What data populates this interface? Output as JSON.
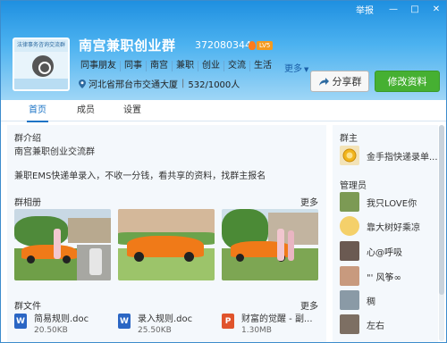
{
  "window": {
    "report_label": "举报",
    "min_glyph": "—",
    "max_glyph": "□",
    "close_glyph": "✕"
  },
  "group": {
    "avatar_banner": "法律事务咨询交流群",
    "name": "南宫兼职创业群",
    "id": "372080344",
    "level_badge": "LV5",
    "tags": [
      "同事朋友",
      "同事",
      "南宫",
      "兼职",
      "创业",
      "交流",
      "生活"
    ],
    "more_label": "更多",
    "location": "河北省邢台市交通大厦",
    "member_count": "532/1000人"
  },
  "actions": {
    "share_label": "分享群",
    "edit_label": "修改资料"
  },
  "tabs": [
    {
      "label": "首页",
      "active": true
    },
    {
      "label": "成员",
      "active": false
    },
    {
      "label": "设置",
      "active": false
    }
  ],
  "intro": {
    "title": "群介绍",
    "line1": "南宫兼职创业交流群",
    "line2": "兼职EMS快递单录入，不收一分钱，看共享的资料，找群主报名"
  },
  "album": {
    "title": "群相册",
    "more_label": "更多"
  },
  "files": {
    "title": "群文件",
    "more_label": "更多",
    "items": [
      {
        "icon": "W",
        "name": "简易规则.doc",
        "size": "20.50KB"
      },
      {
        "icon": "W",
        "name": "录入规则.doc",
        "size": "25.50KB"
      },
      {
        "icon": "P",
        "name": "财富的觉醒 - 副...",
        "size": "1.30MB"
      }
    ]
  },
  "sidebar": {
    "owner_title": "群主",
    "owner": {
      "name": "金手指快递录单..."
    },
    "admin_title": "管理员",
    "admins": [
      {
        "name": "我只LOVE你"
      },
      {
        "name": "靠大树好乘凉"
      },
      {
        "name": "心@呼吸"
      },
      {
        "name": "\"' 风筝∞"
      },
      {
        "name": "稠"
      },
      {
        "name": "左右"
      }
    ]
  },
  "colors": {
    "header_top": "#1e8fe0",
    "accent": "#1a73c6",
    "edit_button": "#46b032",
    "content_bg": "#f4f8fc"
  }
}
